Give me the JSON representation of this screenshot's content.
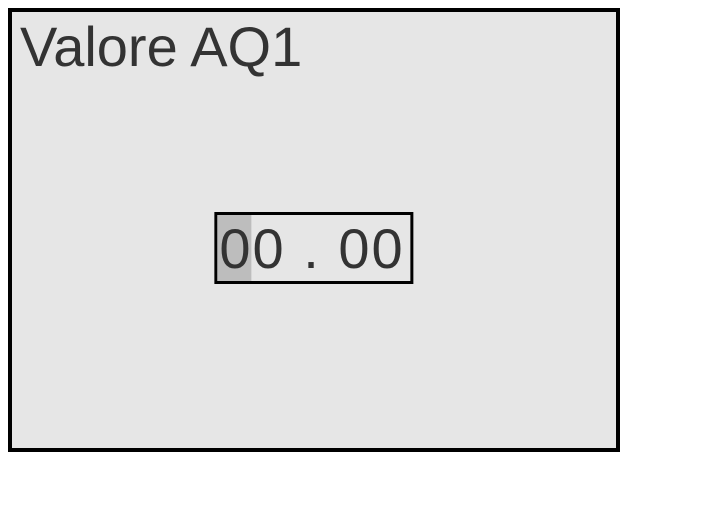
{
  "panel": {
    "title": "Valore AQ1",
    "value_display": "00 . 00"
  }
}
